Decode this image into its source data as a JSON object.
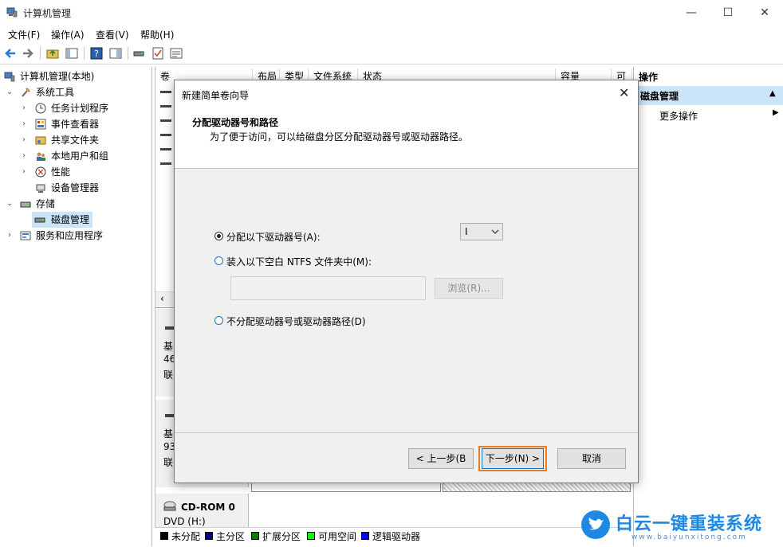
{
  "window": {
    "title": "计算机管理",
    "minimize": "—",
    "maximize": "☐",
    "close": "✕"
  },
  "menu": [
    "文件(F)",
    "操作(A)",
    "查看(V)",
    "帮助(H)"
  ],
  "tree": {
    "root": "计算机管理(本地)",
    "system_tools": "系统工具",
    "task_scheduler": "任务计划程序",
    "event_viewer": "事件查看器",
    "shared_folders": "共享文件夹",
    "local_users": "本地用户和组",
    "performance": "性能",
    "device_manager": "设备管理器",
    "storage": "存储",
    "disk_management": "磁盘管理",
    "services_apps": "服务和应用程序"
  },
  "columns": [
    "卷",
    "布局",
    "类型",
    "文件系统",
    "状态",
    "容量",
    "可"
  ],
  "disk_area": {
    "disk1_lines": [
      "基",
      "46",
      "联"
    ],
    "disk2_lines": [
      "基",
      "93",
      "联"
    ],
    "cdrom_title": "CD-ROM 0",
    "cdrom_sub": "DVD (H:)"
  },
  "legend": [
    "未分配",
    "主分区",
    "扩展分区",
    "可用空间",
    "逻辑驱动器"
  ],
  "actions": {
    "header": "操作",
    "section": "磁盘管理",
    "more": "更多操作"
  },
  "dialog": {
    "title": "新建简单卷向导",
    "heading": "分配驱动器号和路径",
    "description": "为了便于访问，可以给磁盘分区分配驱动器号或驱动器路径。",
    "option_assign": "分配以下驱动器号(A):",
    "drive_letter": "I",
    "option_mount": "装入以下空白 NTFS 文件夹中(M):",
    "folder_path_value": "",
    "browse": "浏览(R)...",
    "option_none": "不分配驱动器号或驱动器路径(D)",
    "back": "< 上一步(B",
    "next": "下一步(N) >",
    "cancel": "取消"
  },
  "watermark": {
    "brand": "白云一键重装系统",
    "url": "www.baiyunxitong.com"
  },
  "colors": {
    "unallocated": "#000000",
    "primary": "#00007f",
    "extended": "#007f00",
    "free": "#00ff00",
    "logical": "#0000ff",
    "highlight_border": "#f07a1e",
    "selection": "#cce4f7",
    "brand_blue": "#1e88e5"
  }
}
